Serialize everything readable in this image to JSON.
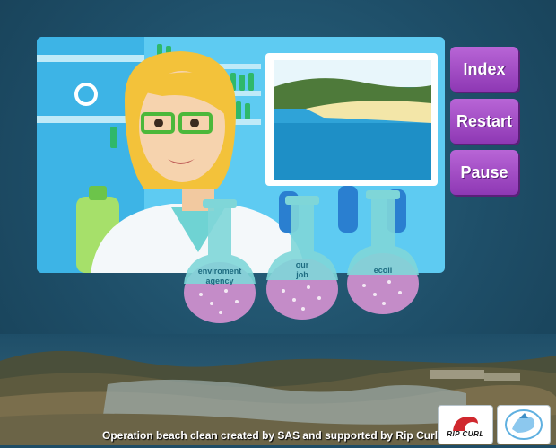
{
  "nav": {
    "index_label": "Index",
    "restart_label": "Restart",
    "pause_label": "Pause"
  },
  "flasks": [
    {
      "label_line1": "enviroment",
      "label_line2": "agency"
    },
    {
      "label_line1": "our",
      "label_line2": "job"
    },
    {
      "label_line1": "ecoli",
      "label_line2": ""
    }
  ],
  "footer": {
    "credit_text": "Operation beach clean created by SAS and supported by Rip Curl",
    "ripcurl_logo_text": "RIP CURL"
  },
  "colors": {
    "background": "#1f4d66",
    "button": "#a04fc4",
    "flask_glass": "#7fd6d8",
    "flask_liquid": "#c48cc8"
  }
}
